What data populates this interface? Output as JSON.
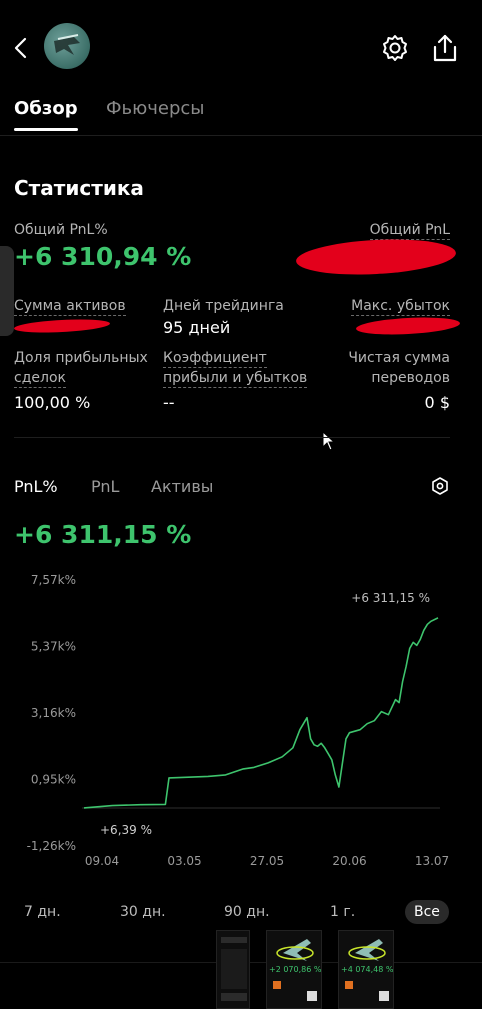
{
  "header": {
    "back_icon": "chevron-left-icon",
    "avatar": "profile-avatar",
    "settings_icon": "gear-icon",
    "share_icon": "share-icon"
  },
  "tabs": [
    {
      "label": "Обзор",
      "active": true
    },
    {
      "label": "Фьючерсы",
      "active": false
    }
  ],
  "stats": {
    "title": "Статистика",
    "total_pnl_pct_label": "Общий PnL%",
    "total_pnl_pct_value": "+6 310,94 %",
    "total_pnl_label": "Общий PnL",
    "assets_label": "Сумма активов",
    "trading_days_label": "Дней трейдинга",
    "trading_days_value": "95 дней",
    "max_loss_label": "Макс. убыток",
    "win_rate_label_1": "Доля прибыльных",
    "win_rate_label_2": "сделок",
    "win_rate_value": "100,00 %",
    "pl_ratio_label_1": "Коэффициент",
    "pl_ratio_label_2": "прибыли и убытков",
    "pl_ratio_value": "--",
    "net_transfer_label_1": "Чистая сумма",
    "net_transfer_label_2": "переводов",
    "net_transfer_value": "0 $",
    "accent_green": "#3ec46d",
    "redaction_red": "#e3001b"
  },
  "chart_tabs": [
    {
      "label": "PnL%",
      "active": true
    },
    {
      "label": "PnL",
      "active": false
    },
    {
      "label": "Активы",
      "active": false
    }
  ],
  "chart_settings_icon": "settings-icon",
  "chart_headline": "+6 311,15 %",
  "chart_data": {
    "type": "line",
    "y_ticks": [
      "7,57k%",
      "5,37k%",
      "3,16k%",
      "0,95k%",
      "-1,26k%"
    ],
    "x_ticks": [
      "09.04",
      "03.05",
      "27.05",
      "20.06",
      "13.07"
    ],
    "start_label": "+6,39 %",
    "end_label": "+6 311,15 %",
    "ylim": [
      -1260,
      7570
    ],
    "grid": false,
    "color": "#3ec46d",
    "x": [
      0,
      8,
      16,
      23,
      24,
      35,
      40,
      45,
      48,
      52,
      56,
      59,
      61,
      63,
      64,
      65,
      66,
      67,
      68,
      69,
      70,
      71,
      72,
      74,
      75,
      78,
      80,
      82,
      84,
      86,
      88,
      89,
      90,
      91,
      92,
      93,
      94,
      95,
      96,
      97,
      98,
      100
    ],
    "y": [
      6,
      80,
      110,
      120,
      1000,
      1050,
      1100,
      1300,
      1350,
      1500,
      1700,
      2000,
      2600,
      3000,
      2300,
      2100,
      2050,
      2150,
      2000,
      1800,
      1600,
      1100,
      700,
      2300,
      2500,
      2600,
      2800,
      2900,
      3200,
      3100,
      3600,
      3500,
      4200,
      4700,
      5300,
      5500,
      5400,
      5600,
      5900,
      6100,
      6200,
      6311
    ]
  },
  "range_buttons": [
    {
      "label": "7 дн.",
      "active": false
    },
    {
      "label": "30 дн.",
      "active": false
    },
    {
      "label": "90 дн.",
      "active": false
    },
    {
      "label": "1 г.",
      "active": false
    },
    {
      "label": "Все",
      "active": true
    }
  ],
  "thumbnails": [
    {
      "caption": ""
    },
    {
      "caption": "+2 070,86 %"
    },
    {
      "caption": "+4 074,48 %"
    }
  ]
}
